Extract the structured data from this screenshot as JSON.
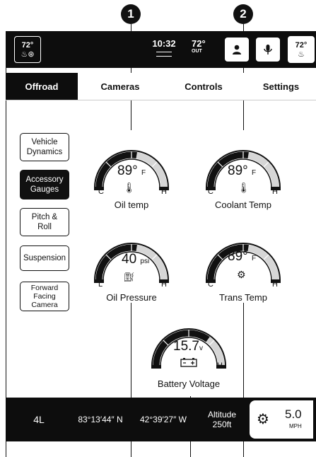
{
  "callouts": {
    "one": "1",
    "two": "2"
  },
  "top_bar": {
    "left_temp": "72°",
    "time": "10:32",
    "outside_temp": "72°",
    "outside_label": "OUT",
    "right_temp": "72°"
  },
  "tabs": [
    {
      "label": "Offroad"
    },
    {
      "label": "Cameras"
    },
    {
      "label": "Controls"
    },
    {
      "label": "Settings"
    }
  ],
  "sidebar": [
    {
      "label": "Vehicle Dynamics"
    },
    {
      "label": "Accessory Gauges"
    },
    {
      "label": "Pitch & Roll"
    },
    {
      "label": "Suspension"
    },
    {
      "label": "Forward Facing Camera"
    }
  ],
  "gauges": {
    "oil_temp": {
      "value": "89°",
      "unit": "F",
      "low": "C",
      "high": "H",
      "label": "Oil temp",
      "level": 0.55
    },
    "coolant_temp": {
      "value": "89°",
      "unit": "F",
      "low": "C",
      "high": "H",
      "label": "Coolant Temp",
      "level": 0.55
    },
    "oil_pressure": {
      "value": "40",
      "unit": "psi",
      "low": "L",
      "high": "H",
      "label": "Oil Pressure",
      "level": 0.55
    },
    "trans_temp": {
      "value": "89°",
      "unit": "F",
      "low": "C",
      "high": "H",
      "label": "Trans Temp",
      "level": 0.55
    },
    "battery_voltage": {
      "value": "15.7",
      "unit": "v",
      "low": "L",
      "high": "H",
      "label": "Battery Voltage",
      "level": 0.7
    }
  },
  "bottom_bar": {
    "gear": "4L",
    "latitude": "83°13′44″ N",
    "longitude": "42°39′27″ W",
    "altitude_label": "Altitude",
    "altitude_value": "250ft",
    "speed_value": "5.0",
    "speed_unit": "MPH"
  },
  "colors": {
    "bar": "#0d0d0d",
    "background": "#ffffff",
    "text": "#111111"
  }
}
